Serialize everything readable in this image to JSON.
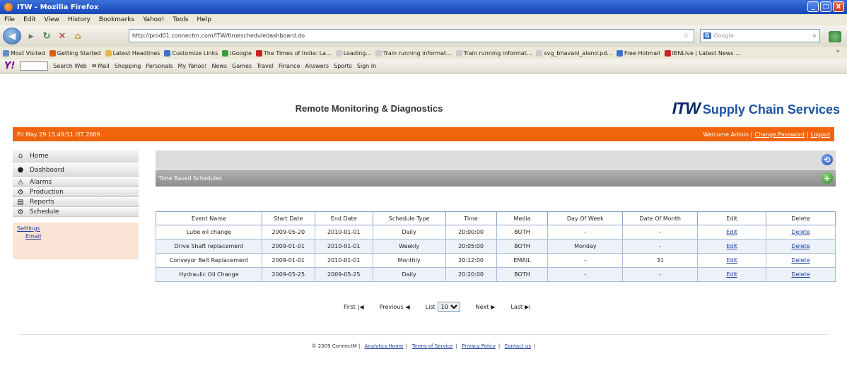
{
  "window": {
    "title": "ITW - Mozilla Firefox",
    "buttons": [
      "_",
      "□",
      "X"
    ]
  },
  "menu": [
    "File",
    "Edit",
    "View",
    "History",
    "Bookmarks",
    "Yahoo!",
    "Tools",
    "Help"
  ],
  "nav": {
    "url": "http://prod01.connectm.com/ITW/timescheduledashboard.do",
    "search_placeholder": "Google"
  },
  "bookmarks": [
    {
      "label": "Most Visited",
      "color": "#6a8cc8"
    },
    {
      "label": "Getting Started",
      "color": "#e25b10"
    },
    {
      "label": "Latest Headlines",
      "color": "#e8b54a"
    },
    {
      "label": "Customize Links",
      "color": "#3b73c8"
    },
    {
      "label": "iGoogle",
      "color": "#3b9b3b"
    },
    {
      "label": "The Times of India: La...",
      "color": "#cc2222"
    },
    {
      "label": "Loading...",
      "color": "#cccccc"
    },
    {
      "label": "Train running informat...",
      "color": "#cccccc"
    },
    {
      "label": "Train running informat...",
      "color": "#cccccc"
    },
    {
      "label": "svg_bhavani_aland.pd...",
      "color": "#cccccc"
    },
    {
      "label": "Free Hotmail",
      "color": "#3b73c8"
    },
    {
      "label": "IBNLive | Latest News ...",
      "color": "#cc2222"
    }
  ],
  "yahoo": [
    "Search Web",
    "Mail",
    "Shopping",
    "Personals",
    "My Yahoo!",
    "News",
    "Games",
    "Travel",
    "Finance",
    "Answers",
    "Sports",
    "Sign In"
  ],
  "header": {
    "title": "Remote Monitoring & Diagnostics",
    "brand_itw": "ITW",
    "brand_scs": "Supply Chain Services"
  },
  "topbar": {
    "date": "Fri May 29 15:49:51 IST 2009",
    "welcome": "Welcome Admin |",
    "change_password": "Change Password",
    "logout": "Logout"
  },
  "sidebar": {
    "items": [
      "Home",
      "Dashboard",
      "Alarms",
      "Production",
      "Reports",
      "Schedule"
    ],
    "settings": "Settings",
    "email": "Email"
  },
  "panel": {
    "header": "Time Based Schedules"
  },
  "table": {
    "columns": [
      "Event Name",
      "Start Date",
      "End Date",
      "Schedule Type",
      "Time",
      "Media",
      "Day Of Week",
      "Date Of Month",
      "Edit",
      "Delete"
    ],
    "rows": [
      [
        "Lube oil change",
        "2009-05-20",
        "2010-01-01",
        "Daily",
        "20:00:00",
        "BOTH",
        "-",
        "-",
        "Edit",
        "Delete"
      ],
      [
        "Drive Shaft replacement",
        "2009-01-01",
        "2010-01-01",
        "Weekly",
        "20:05:00",
        "BOTH",
        "Monday",
        "-",
        "Edit",
        "Delete"
      ],
      [
        "Conveyor Belt Replacement",
        "2009-01-01",
        "2010-01-01",
        "Monthly",
        "20:12:00",
        "EMAIL",
        "-",
        "31",
        "Edit",
        "Delete"
      ],
      [
        "Hydraulic Oil Change",
        "2009-05-25",
        "2009-05-25",
        "Daily",
        "20:20:00",
        "BOTH",
        "-",
        "-",
        "Edit",
        "Delete"
      ]
    ]
  },
  "pager": {
    "first": "First",
    "previous": "Previous",
    "list": "List",
    "list_value": "10",
    "next": "Next",
    "last": "Last"
  },
  "footer": {
    "copyright": "© 2009 ConnectM |",
    "links": [
      "Analytics Home",
      "Terms of Service",
      "Privacy Policy",
      "Contact us"
    ]
  }
}
